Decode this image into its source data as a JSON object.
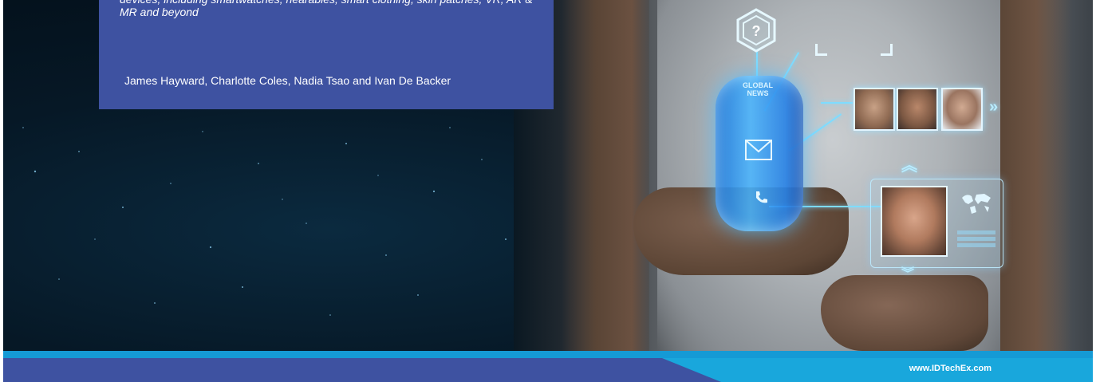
{
  "cover": {
    "subtitle": "devices, including smartwatches, hearables, smart clothing, skin patches, VR, AR & MR and beyond",
    "authors": "James Hayward, Charlotte Coles, Nadia Tsao and Ivan De Backer",
    "website": "www.IDTechEx.com",
    "hologram_ring_text": "GLOBAL NEWS",
    "hex_icon_glyph": "?"
  },
  "colors": {
    "title_box": "#3e52a1",
    "footer_navy": "#3e52a1",
    "footer_cyan": "#19a7dc",
    "hologram_glow": "#7fdcff"
  },
  "icons": [
    "question-hexagon-icon",
    "envelope-icon",
    "phone-icon",
    "world-map-icon",
    "double-chevron-right-icon",
    "chevron-up-icon",
    "chevron-down-icon"
  ]
}
